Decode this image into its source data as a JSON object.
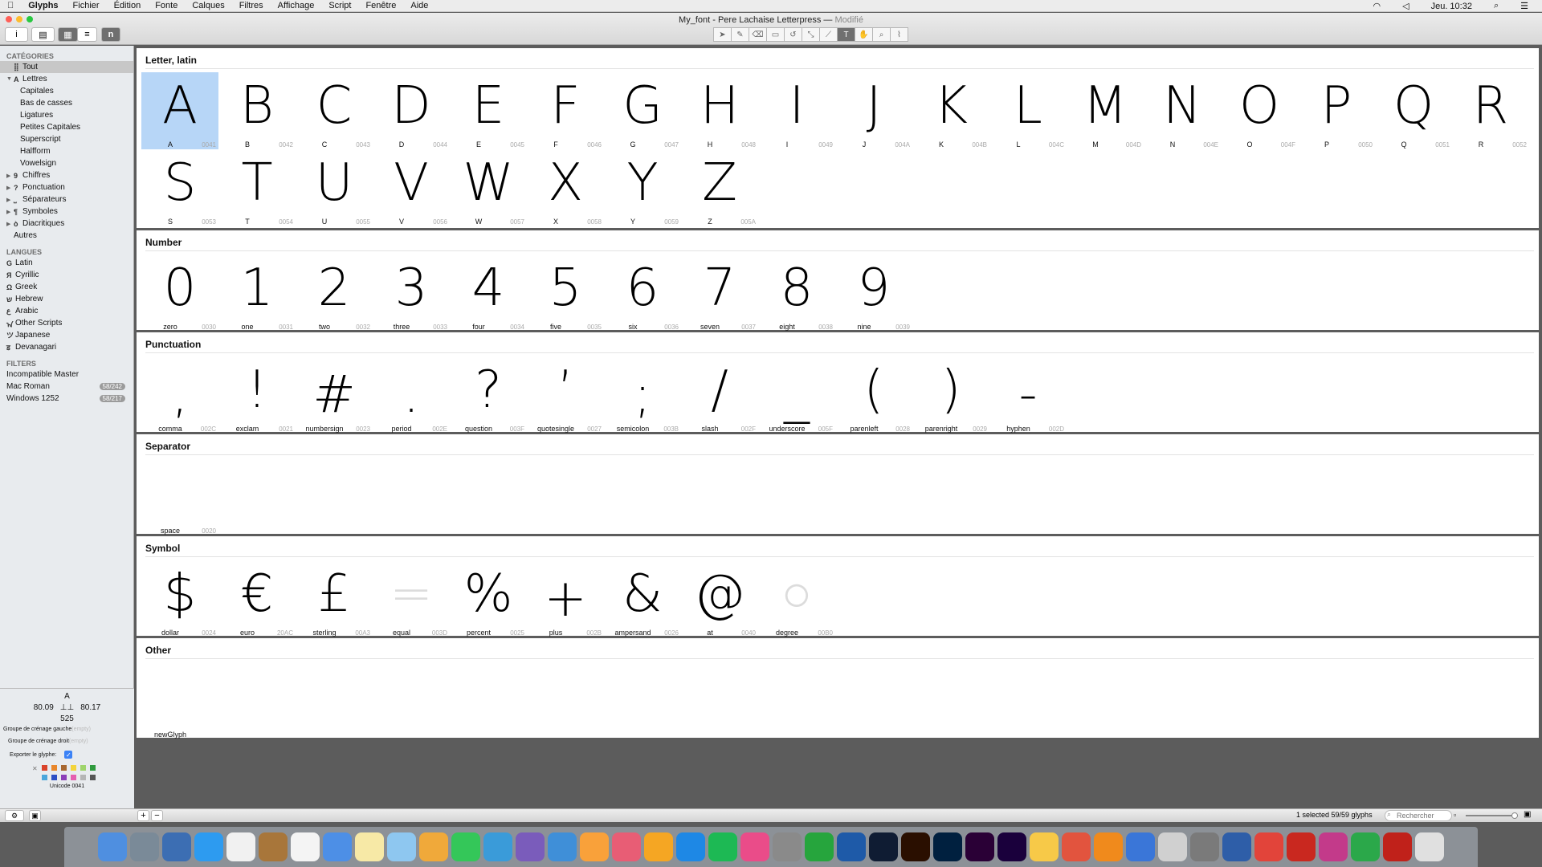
{
  "menubar": {
    "apple": "",
    "items": [
      "Glyphs",
      "Fichier",
      "Édition",
      "Fonte",
      "Calques",
      "Filtres",
      "Affichage",
      "Script",
      "Fenêtre",
      "Aide"
    ],
    "clock": "Jeu. 10:32"
  },
  "window": {
    "title": "My_font - Pere Lachaise Letterpress —",
    "modified": "Modifié"
  },
  "sidebar": {
    "categories_header": "CATÉGORIES",
    "categories": [
      {
        "label": "Tout",
        "selected": true,
        "arrow": "",
        "icon": "⣿"
      },
      {
        "label": "Lettres",
        "arrow": "▼",
        "icon": "A"
      },
      {
        "label": "Capitales",
        "arrow": "",
        "icon": "",
        "indent": true
      },
      {
        "label": "Bas de casses",
        "arrow": "",
        "icon": "",
        "indent": true
      },
      {
        "label": "Ligatures",
        "arrow": "",
        "icon": "",
        "indent": true
      },
      {
        "label": "Petites Capitales",
        "arrow": "",
        "icon": "",
        "indent": true
      },
      {
        "label": "Superscript",
        "arrow": "",
        "icon": "",
        "indent": true
      },
      {
        "label": "Halfform",
        "arrow": "",
        "icon": "",
        "indent": true
      },
      {
        "label": "Vowelsign",
        "arrow": "",
        "icon": "",
        "indent": true
      },
      {
        "label": "Chiffres",
        "arrow": "▶",
        "icon": "9"
      },
      {
        "label": "Ponctuation",
        "arrow": "▶",
        "icon": "?"
      },
      {
        "label": "Séparateurs",
        "arrow": "▶",
        "icon": "⎵"
      },
      {
        "label": "Symboles",
        "arrow": "▶",
        "icon": "¶"
      },
      {
        "label": "Diacritiques",
        "arrow": "▶",
        "icon": "ò"
      },
      {
        "label": "Autres",
        "arrow": "",
        "icon": ""
      }
    ],
    "languages_header": "LANGUES",
    "languages": [
      {
        "label": "Latin",
        "icon": "G"
      },
      {
        "label": "Cyrillic",
        "icon": "Я"
      },
      {
        "label": "Greek",
        "icon": "Ω"
      },
      {
        "label": "Hebrew",
        "icon": "ש"
      },
      {
        "label": "Arabic",
        "icon": "ع"
      },
      {
        "label": "Other Scripts",
        "icon": "ᠠ"
      },
      {
        "label": "Japanese",
        "icon": "ツ"
      },
      {
        "label": "Devanagari",
        "icon": "ड"
      }
    ],
    "filters_header": "FILTERS",
    "filters": [
      {
        "label": "Incompatible Master",
        "badge": ""
      },
      {
        "label": "Mac Roman",
        "badge": "58/242"
      },
      {
        "label": "Windows 1252",
        "badge": "58/217"
      }
    ]
  },
  "info": {
    "glyph": "A",
    "lsb": "80.09",
    "rsb": "80.17",
    "width": "525",
    "left_group_label": "Groupe de crénage gauche",
    "left_group_ph": "(empty)",
    "right_group_label": "Groupe de crénage droit",
    "right_group_ph": "(empty)",
    "export_label": "Exporter le glyphe:",
    "unicode": "Unicode 0041",
    "colors": [
      "#d9432b",
      "#e8862a",
      "#a7672f",
      "#f3d43b",
      "#9fd46b",
      "#2f9a3d",
      "#4aa6db",
      "#2d4fc5",
      "#8b3fb8",
      "#e55eb0",
      "#b5b5b5",
      "#555555"
    ]
  },
  "sections": [
    {
      "title": "Letter, latin",
      "glyphs": [
        {
          "c": "A",
          "n": "A",
          "u": "0041",
          "sel": true
        },
        {
          "c": "B",
          "n": "B",
          "u": "0042"
        },
        {
          "c": "C",
          "n": "C",
          "u": "0043"
        },
        {
          "c": "D",
          "n": "D",
          "u": "0044"
        },
        {
          "c": "E",
          "n": "E",
          "u": "0045"
        },
        {
          "c": "F",
          "n": "F",
          "u": "0046"
        },
        {
          "c": "G",
          "n": "G",
          "u": "0047"
        },
        {
          "c": "H",
          "n": "H",
          "u": "0048"
        },
        {
          "c": "I",
          "n": "I",
          "u": "0049"
        },
        {
          "c": "J",
          "n": "J",
          "u": "004A"
        },
        {
          "c": "K",
          "n": "K",
          "u": "004B"
        },
        {
          "c": "L",
          "n": "L",
          "u": "004C"
        },
        {
          "c": "M",
          "n": "M",
          "u": "004D"
        },
        {
          "c": "N",
          "n": "N",
          "u": "004E"
        },
        {
          "c": "O",
          "n": "O",
          "u": "004F"
        },
        {
          "c": "P",
          "n": "P",
          "u": "0050"
        },
        {
          "c": "Q",
          "n": "Q",
          "u": "0051"
        },
        {
          "c": "R",
          "n": "R",
          "u": "0052"
        },
        {
          "c": "S",
          "n": "S",
          "u": "0053"
        },
        {
          "c": "T",
          "n": "T",
          "u": "0054"
        },
        {
          "c": "U",
          "n": "U",
          "u": "0055"
        },
        {
          "c": "V",
          "n": "V",
          "u": "0056"
        },
        {
          "c": "W",
          "n": "W",
          "u": "0057"
        },
        {
          "c": "X",
          "n": "X",
          "u": "0058"
        },
        {
          "c": "Y",
          "n": "Y",
          "u": "0059"
        },
        {
          "c": "Z",
          "n": "Z",
          "u": "005A"
        }
      ]
    },
    {
      "title": "Number",
      "glyphs": [
        {
          "c": "0",
          "n": "zero",
          "u": "0030"
        },
        {
          "c": "1",
          "n": "one",
          "u": "0031"
        },
        {
          "c": "2",
          "n": "two",
          "u": "0032"
        },
        {
          "c": "3",
          "n": "three",
          "u": "0033"
        },
        {
          "c": "4",
          "n": "four",
          "u": "0034"
        },
        {
          "c": "5",
          "n": "five",
          "u": "0035"
        },
        {
          "c": "6",
          "n": "six",
          "u": "0036"
        },
        {
          "c": "7",
          "n": "seven",
          "u": "0037"
        },
        {
          "c": "8",
          "n": "eight",
          "u": "0038"
        },
        {
          "c": "9",
          "n": "nine",
          "u": "0039"
        }
      ]
    },
    {
      "title": "Punctuation",
      "glyphs": [
        {
          "c": ",",
          "n": "comma",
          "u": "002C"
        },
        {
          "c": "!",
          "n": "exclam",
          "u": "0021"
        },
        {
          "c": "#",
          "n": "numbersign",
          "u": "0023"
        },
        {
          "c": ".",
          "n": "period",
          "u": "002E"
        },
        {
          "c": "?",
          "n": "question",
          "u": "003F"
        },
        {
          "c": "’",
          "n": "quotesingle",
          "u": "0027"
        },
        {
          "c": ";",
          "n": "semicolon",
          "u": "003B"
        },
        {
          "c": "/",
          "n": "slash",
          "u": "002F"
        },
        {
          "c": "_",
          "n": "underscore",
          "u": "005F"
        },
        {
          "c": "(",
          "n": "parenleft",
          "u": "0028"
        },
        {
          "c": ")",
          "n": "parenright",
          "u": "0029"
        },
        {
          "c": "-",
          "n": "hyphen",
          "u": "002D"
        }
      ]
    },
    {
      "title": "Separator",
      "glyphs": [
        {
          "c": "",
          "n": "space",
          "u": "0020"
        }
      ]
    },
    {
      "title": "Symbol",
      "glyphs": [
        {
          "c": "$",
          "n": "dollar",
          "u": "0024"
        },
        {
          "c": "€",
          "n": "euro",
          "u": "20AC"
        },
        {
          "c": "£",
          "n": "sterling",
          "u": "00A3"
        },
        {
          "c": "=",
          "n": "equal",
          "u": "003D",
          "faint": true
        },
        {
          "c": "%",
          "n": "percent",
          "u": "0025"
        },
        {
          "c": "+",
          "n": "plus",
          "u": "002B"
        },
        {
          "c": "&",
          "n": "ampersand",
          "u": "0026"
        },
        {
          "c": "@",
          "n": "at",
          "u": "0040"
        },
        {
          "c": "○",
          "n": "degree",
          "u": "00B0",
          "faint": true
        }
      ]
    },
    {
      "title": "Other",
      "glyphs": [
        {
          "c": "",
          "n": "newGlyph",
          "u": ""
        }
      ]
    }
  ],
  "status": {
    "selection": "1 selected 59/59 glyphs",
    "search_ph": "Rechercher"
  },
  "dock": {
    "colors": [
      "#4f8fe0",
      "#7a8a98",
      "#3c6eb3",
      "#2d9bf0",
      "#f1f1f1",
      "#a8763a",
      "#f4f4f4",
      "#4d8fe6",
      "#f7e9a6",
      "#8ec7f0",
      "#f0a93a",
      "#34c759",
      "#3a9bd9",
      "#7a5cbb",
      "#3f8fd8",
      "#f9a13a",
      "#e85d75",
      "#f5a623",
      "#1e88e5",
      "#1db954",
      "#ea4c89",
      "#8a8a8a",
      "#26a53d",
      "#1e5aa8",
      "#0f1c33",
      "#2a0f00",
      "#00203f",
      "#2a0036",
      "#1a003c",
      "#f7c948",
      "#e2543e",
      "#f08a1c",
      "#3a76d8",
      "#d0d0d0",
      "#7a7a7a",
      "#2e5ea8",
      "#e2443a",
      "#c9281f",
      "#c33a8a",
      "#2ba84a",
      "#c0211a",
      "#e0e0e0"
    ]
  }
}
